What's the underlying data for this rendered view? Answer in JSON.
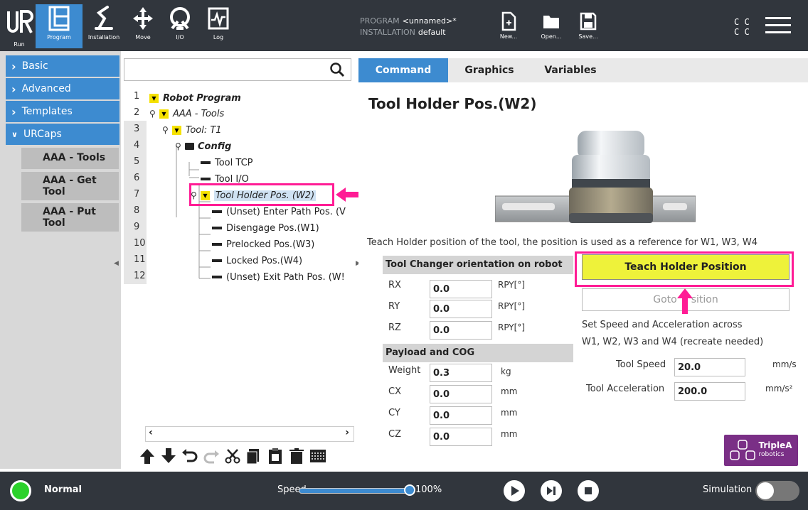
{
  "header": {
    "nav": [
      {
        "label": "Run"
      },
      {
        "label": "Program"
      },
      {
        "label": "Installation"
      },
      {
        "label": "Move"
      },
      {
        "label": "I/O"
      },
      {
        "label": "Log"
      }
    ],
    "program_key": "PROGRAM",
    "program_value": "<unnamed>*",
    "installation_key": "INSTALLATION",
    "installation_value": "default",
    "file_buttons": [
      {
        "label": "New..."
      },
      {
        "label": "Open..."
      },
      {
        "label": "Save..."
      }
    ],
    "cc_top": "C C",
    "cc_bottom": "C C"
  },
  "left_panel": {
    "categories": [
      {
        "label": "Basic",
        "expanded": false
      },
      {
        "label": "Advanced",
        "expanded": false
      },
      {
        "label": "Templates",
        "expanded": false
      },
      {
        "label": "URCaps",
        "expanded": true
      }
    ],
    "urcaps_items": [
      {
        "label": "AAA - Tools"
      },
      {
        "label": "AAA - Get Tool"
      },
      {
        "label": "AAA - Put Tool"
      }
    ]
  },
  "tree": {
    "line_numbers": [
      "1",
      "2",
      "3",
      "4",
      "5",
      "6",
      "7",
      "8",
      "9",
      "10",
      "11",
      "12"
    ],
    "nodes": [
      {
        "text": "Robot Program"
      },
      {
        "text": "AAA - Tools"
      },
      {
        "text": "Tool: T1"
      },
      {
        "text": "Config"
      },
      {
        "text": "Tool TCP"
      },
      {
        "text": "Tool I/O"
      },
      {
        "text": "Tool Holder Pos. (W2)"
      },
      {
        "text": "(Unset) Enter Path Pos. (V"
      },
      {
        "text": "Disengage Pos.(W1)"
      },
      {
        "text": "Prelocked Pos.(W3)"
      },
      {
        "text": "Locked Pos.(W4)"
      },
      {
        "text": "(Unset) Exit Path Pos. (W!"
      }
    ]
  },
  "right_panel": {
    "tabs": [
      {
        "label": "Command",
        "active": true
      },
      {
        "label": "Graphics",
        "active": false
      },
      {
        "label": "Variables",
        "active": false
      }
    ],
    "title": "Tool Holder Pos.(W2)",
    "description": "Teach Holder position of the tool, the position is used as a reference for W1, W3, W4",
    "orientation_header": "Tool Changer orientation on robot",
    "orientation": [
      {
        "label": "RX",
        "value": "0.0",
        "unit": "RPY[°]"
      },
      {
        "label": "RY",
        "value": "0.0",
        "unit": "RPY[°]"
      },
      {
        "label": "RZ",
        "value": "0.0",
        "unit": "RPY[°]"
      }
    ],
    "payload_header": "Payload and COG",
    "payload": [
      {
        "label": "Weight",
        "value": "0.3",
        "unit": "kg"
      },
      {
        "label": "CX",
        "value": "0.0",
        "unit": "mm"
      },
      {
        "label": "CY",
        "value": "0.0",
        "unit": "mm"
      },
      {
        "label": "CZ",
        "value": "0.0",
        "unit": "mm"
      }
    ],
    "teach_button": "Teach Holder Position",
    "goto_left": "Goto ",
    "goto_right": "sition",
    "speed_desc_1": "Set Speed and Acceleration across",
    "speed_desc_2": "W1, W2, W3 and W4 (recreate needed)",
    "tool_speed_label": "Tool Speed",
    "tool_speed_value": "20.0",
    "tool_speed_unit": "mm/s",
    "tool_accel_label": "Tool Acceleration",
    "tool_accel_value": "200.0",
    "tool_accel_unit": "mm/s²",
    "logo_line1": "TripleA",
    "logo_line2": "robotics"
  },
  "footer": {
    "status": "Normal",
    "status_color": "#2bd12b",
    "speed_label": "Speed",
    "speed_value": "100%",
    "speed_fraction": 1.0,
    "simulation_label": "Simulation"
  },
  "colors": {
    "accent": "#3d8bd0",
    "header": "#31363d",
    "highlight": "#ff1c95",
    "teach_button": "#eef23a",
    "tree_triangle": "#f5e100",
    "logo": "#7a2f86"
  }
}
